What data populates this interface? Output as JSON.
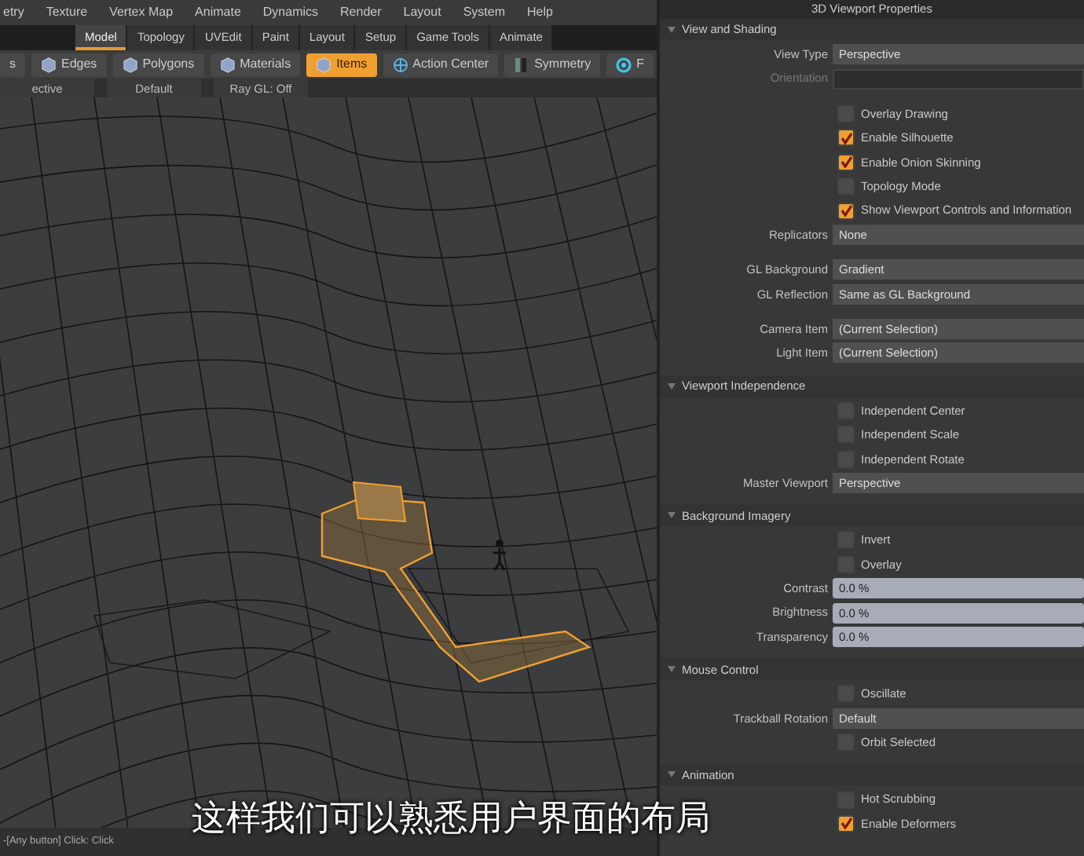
{
  "menu": [
    "etry",
    "Texture",
    "Vertex Map",
    "Animate",
    "Dynamics",
    "Render",
    "Layout",
    "System",
    "Help"
  ],
  "layout_tabs": [
    {
      "label": "Model",
      "selected": true
    },
    {
      "label": "Topology",
      "selected": false
    },
    {
      "label": "UVEdit",
      "selected": false
    },
    {
      "label": "Paint",
      "selected": false
    },
    {
      "label": "Layout",
      "selected": false
    },
    {
      "label": "Setup",
      "selected": false
    },
    {
      "label": "Game Tools",
      "selected": false
    },
    {
      "label": "Animate",
      "selected": false
    }
  ],
  "toolbar": [
    {
      "label": "s",
      "kind": "text",
      "selected": false
    },
    {
      "label": "Edges",
      "kind": "cube",
      "selected": false
    },
    {
      "label": "Polygons",
      "kind": "cube",
      "selected": false
    },
    {
      "label": "Materials",
      "kind": "cube",
      "selected": false
    },
    {
      "label": "Items",
      "kind": "cube",
      "selected": true
    },
    {
      "label": "Action Center",
      "kind": "target",
      "selected": false
    },
    {
      "label": "Symmetry",
      "kind": "mirror",
      "selected": false
    },
    {
      "label": "F",
      "kind": "ring",
      "selected": false
    }
  ],
  "viewport_options": [
    "ective",
    "Default",
    "Ray GL: Off"
  ],
  "status_bar": "-[Any button] Click:  Click",
  "subtitle": "这样我们可以熟悉用户界面的布局",
  "panel": {
    "title": "3D Viewport Properties",
    "sections": [
      {
        "name": "View and Shading",
        "groups": [
          [
            {
              "kind": "dropdown",
              "label": "View Type",
              "value": "Perspective"
            },
            {
              "kind": "dropdown",
              "label": "Orientation",
              "disabled": true
            }
          ],
          [
            {
              "kind": "checkbox",
              "label": "Overlay Drawing",
              "checked": false
            },
            {
              "kind": "checkbox",
              "label": "Enable Silhouette",
              "checked": true
            },
            {
              "kind": "checkbox",
              "label": "Enable Onion Skinning",
              "checked": true
            },
            {
              "kind": "checkbox",
              "label": "Topology Mode",
              "checked": false
            },
            {
              "kind": "checkbox",
              "label": "Show Viewport Controls and Information",
              "checked": true
            },
            {
              "kind": "dropdown",
              "label": "Replicators",
              "value": "None"
            }
          ],
          [
            {
              "kind": "dropdown",
              "label": "GL Background",
              "value": "Gradient"
            },
            {
              "kind": "dropdown",
              "label": "GL Reflection",
              "value": "Same as GL Background"
            }
          ],
          [
            {
              "kind": "dropdown",
              "label": "Camera Item",
              "value": "(Current Selection)"
            },
            {
              "kind": "dropdown",
              "label": "Light Item",
              "value": "(Current Selection)"
            }
          ]
        ]
      },
      {
        "name": "Viewport Independence",
        "groups": [
          [
            {
              "kind": "checkbox",
              "label": "Independent Center",
              "checked": false
            },
            {
              "kind": "checkbox",
              "label": "Independent Scale",
              "checked": false
            },
            {
              "kind": "checkbox",
              "label": "Independent Rotate",
              "checked": false
            },
            {
              "kind": "dropdown",
              "label": "Master Viewport",
              "value": "Perspective"
            }
          ]
        ]
      },
      {
        "name": "Background Imagery",
        "groups": [
          [
            {
              "kind": "checkbox",
              "label": "Invert",
              "checked": false
            },
            {
              "kind": "checkbox",
              "label": "Overlay",
              "checked": false
            },
            {
              "kind": "percent",
              "label": "Contrast",
              "value": "0.0 %"
            },
            {
              "kind": "percent",
              "label": "Brightness",
              "value": "0.0 %"
            },
            {
              "kind": "percent",
              "label": "Transparency",
              "value": "0.0 %"
            }
          ]
        ]
      },
      {
        "name": "Mouse Control",
        "groups": [
          [
            {
              "kind": "checkbox",
              "label": "Oscillate",
              "checked": false
            },
            {
              "kind": "dropdown",
              "label": "Trackball Rotation",
              "value": "Default"
            },
            {
              "kind": "checkbox",
              "label": "Orbit Selected",
              "checked": false
            }
          ]
        ]
      },
      {
        "name": "Animation",
        "groups": [
          [
            {
              "kind": "checkbox",
              "label": "Hot Scrubbing",
              "checked": false
            },
            {
              "kind": "checkbox",
              "label": "Enable Deformers",
              "checked": true
            }
          ]
        ]
      }
    ]
  }
}
